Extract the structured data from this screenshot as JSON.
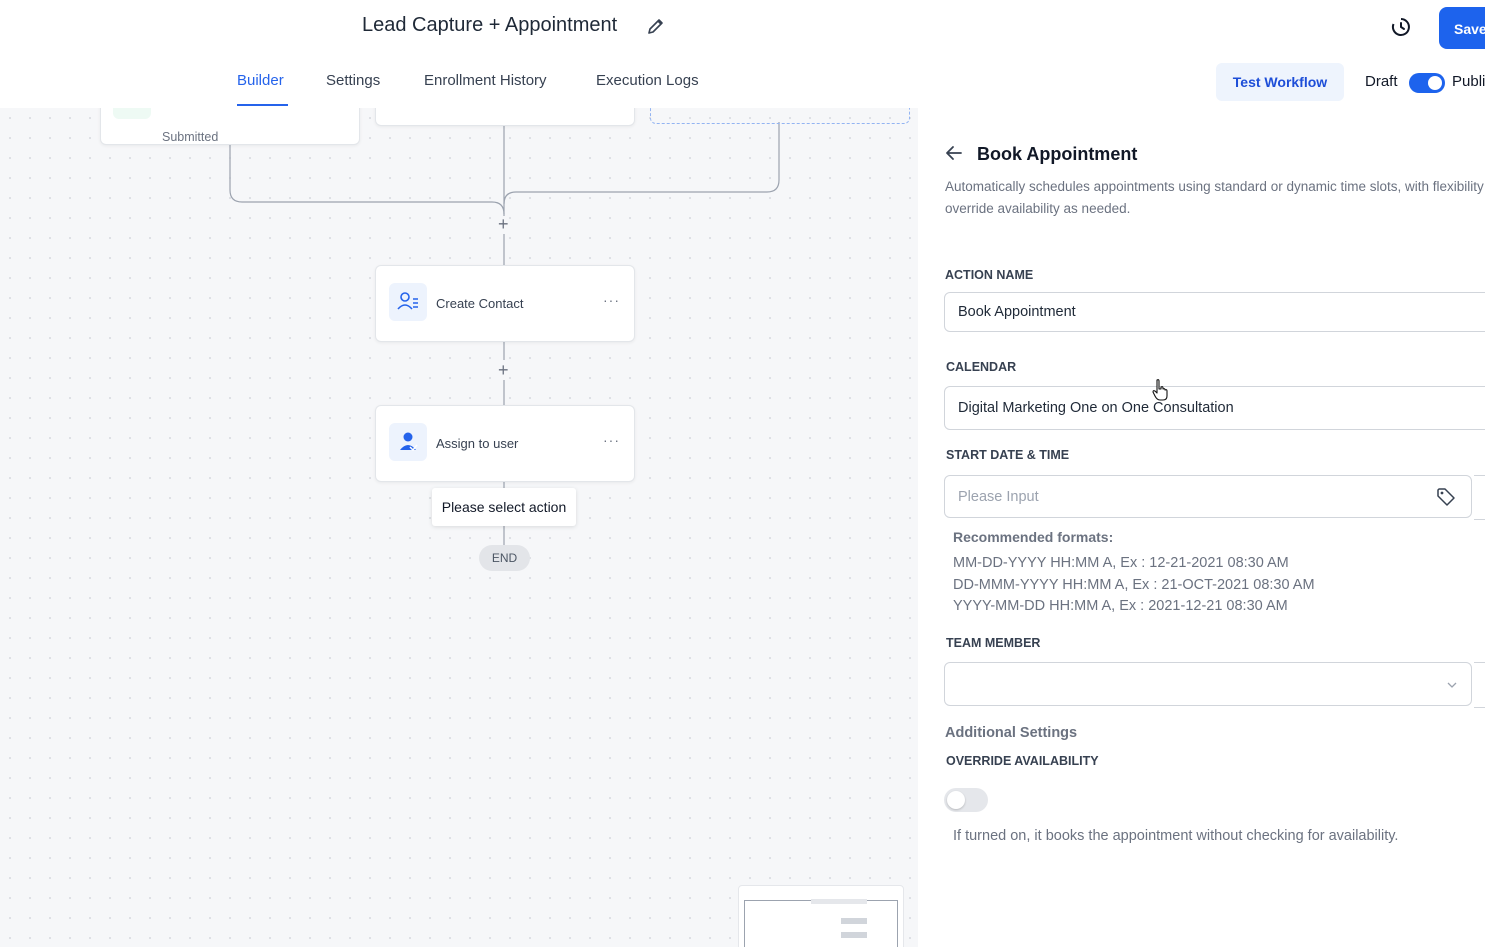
{
  "header": {
    "title": "Lead Capture + Appointment",
    "save_label": "Save",
    "icons": [
      "edit-icon",
      "history-icon"
    ]
  },
  "tabs": [
    {
      "label": "Builder",
      "active": true
    },
    {
      "label": "Settings"
    },
    {
      "label": "Enrollment History"
    },
    {
      "label": "Execution Logs"
    }
  ],
  "toolbar": {
    "test_workflow_label": "Test Workflow",
    "draft_label": "Draft",
    "publish_label": "Publish",
    "published": true
  },
  "canvas": {
    "trigger_caption": "Submitted",
    "nodes": [
      {
        "label": "Create Contact",
        "icon": "contact-list-icon"
      },
      {
        "label": "Assign to user",
        "icon": "assign-user-icon"
      }
    ],
    "tooltip": "Please select action",
    "end_label": "END",
    "plus": "+",
    "more": "···"
  },
  "panel": {
    "title": "Book Appointment",
    "description": "Automatically schedules appointments using standard or dynamic time slots, with flexibility to override availability as needed.",
    "action_name_label": "ACTION NAME",
    "action_name_value": "Book Appointment",
    "calendar_label": "CALENDAR",
    "calendar_value": "Digital Marketing One on One Consultation",
    "start_label": "START DATE & TIME",
    "start_placeholder": "Please Input",
    "formats_heading": "Recommended formats:",
    "formats": [
      "MM-DD-YYYY HH:MM A, Ex : 12-21-2021 08:30 AM",
      "DD-MMM-YYYY HH:MM A, Ex : 21-OCT-2021 08:30 AM",
      "YYYY-MM-DD HH:MM A, Ex : 2021-12-21 08:30 AM"
    ],
    "team_member_label": "TEAM MEMBER",
    "team_member_value": "",
    "additional_settings_label": "Additional Settings",
    "override_label": "OVERRIDE AVAILABILITY",
    "override_on": false,
    "override_help": "If turned on, it books the appointment without checking for availability."
  },
  "colors": {
    "accent": "#1d63ed",
    "canvas_bg": "#f6f7f9",
    "muted_text": "#6b7280"
  }
}
